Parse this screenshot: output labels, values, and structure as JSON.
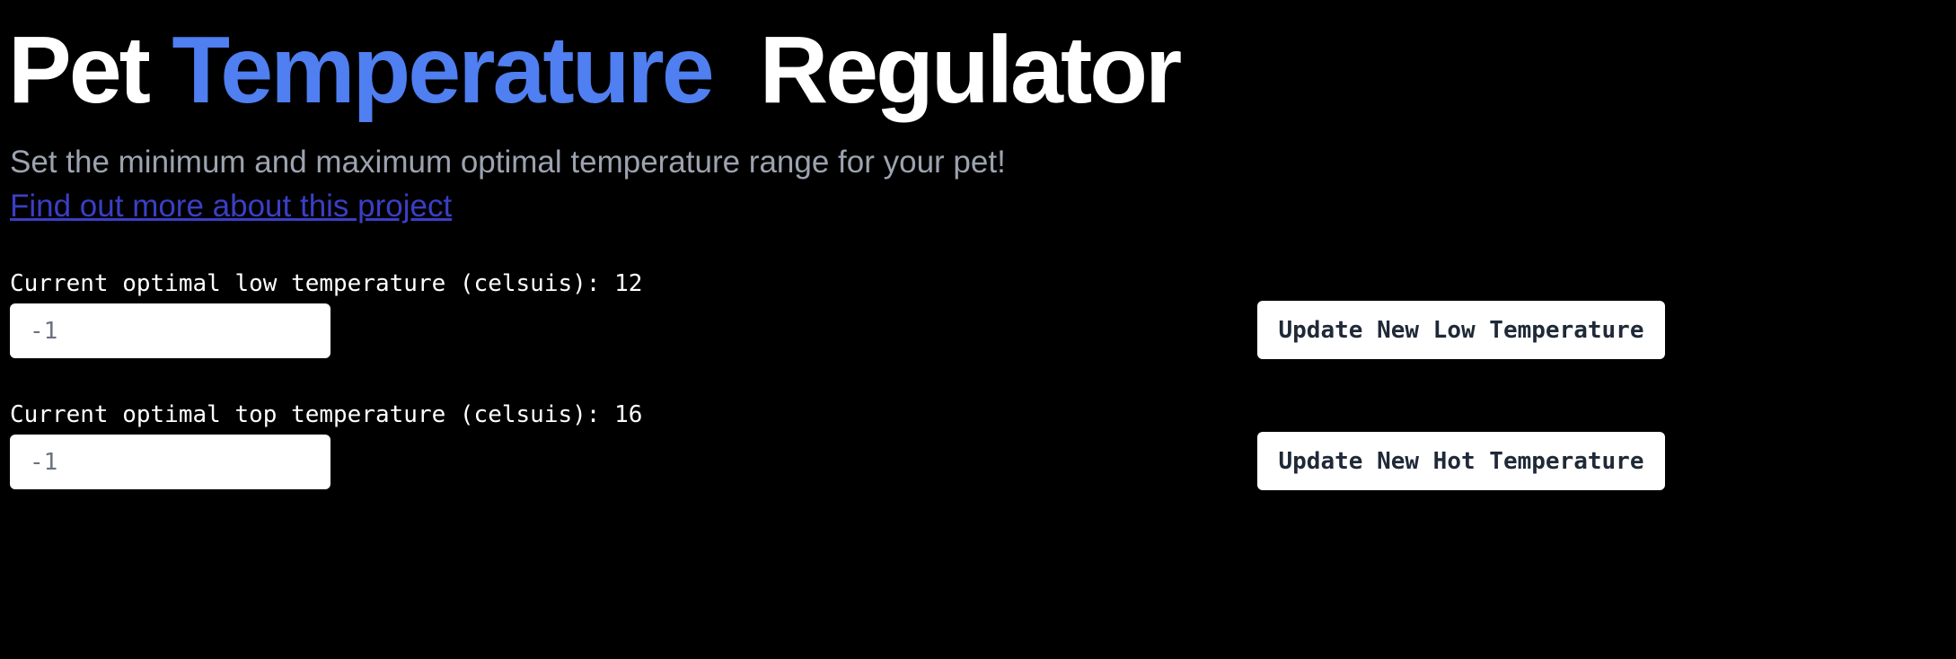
{
  "header": {
    "title_part1": "Pet",
    "title_accent": "Temperature",
    "title_part2": "Regulator",
    "subtitle": "Set the minimum and maximum optimal temperature range for your pet!",
    "link_text": "Find out more about this project"
  },
  "low": {
    "label": "Current optimal low temperature (celsuis): 12",
    "input_value": "-1",
    "button_label": "Update New Low Temperature"
  },
  "top": {
    "label": "Current optimal top temperature (celsuis): 16",
    "input_value": "-1",
    "button_label": "Update New Hot Temperature"
  },
  "colors": {
    "background": "#000000",
    "accent": "#4f7ff0",
    "link": "#3b3fc4",
    "subtitle": "#9ca3af"
  }
}
